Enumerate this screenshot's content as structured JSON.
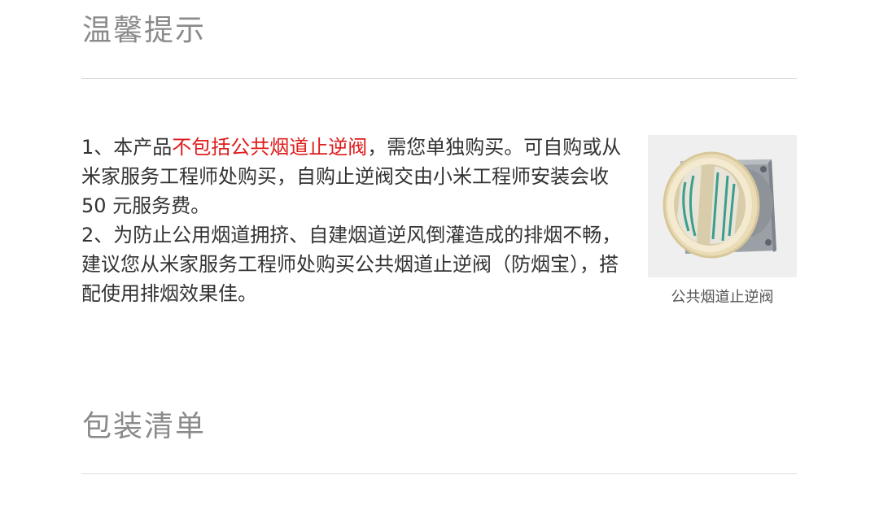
{
  "sections": {
    "notice_title": "温馨提示",
    "packing_title": "包装清单"
  },
  "notice": {
    "item1_prefix": "1、本产品",
    "item1_highlight": "不包括公共烟道止逆阀",
    "item1_suffix": "，需您单独购买。可自购或从米家服务工程师处购买，自购止逆阀交由小米工程师安装会收 50 元服务费。",
    "item2": "2、为防止公用烟道拥挤、自建烟道逆风倒灌造成的排烟不畅，建议您从米家服务工程师处购买公共烟道止逆阀（防烟宝），搭配使用排烟效果佳。"
  },
  "product_image": {
    "caption": "公共烟道止逆阀",
    "icon": "check-valve-image"
  },
  "colors": {
    "highlight": "#e01b1b",
    "title": "#8a8a8a",
    "text": "#333333",
    "divider": "#dcdcdc",
    "image_bg": "#efefef"
  }
}
